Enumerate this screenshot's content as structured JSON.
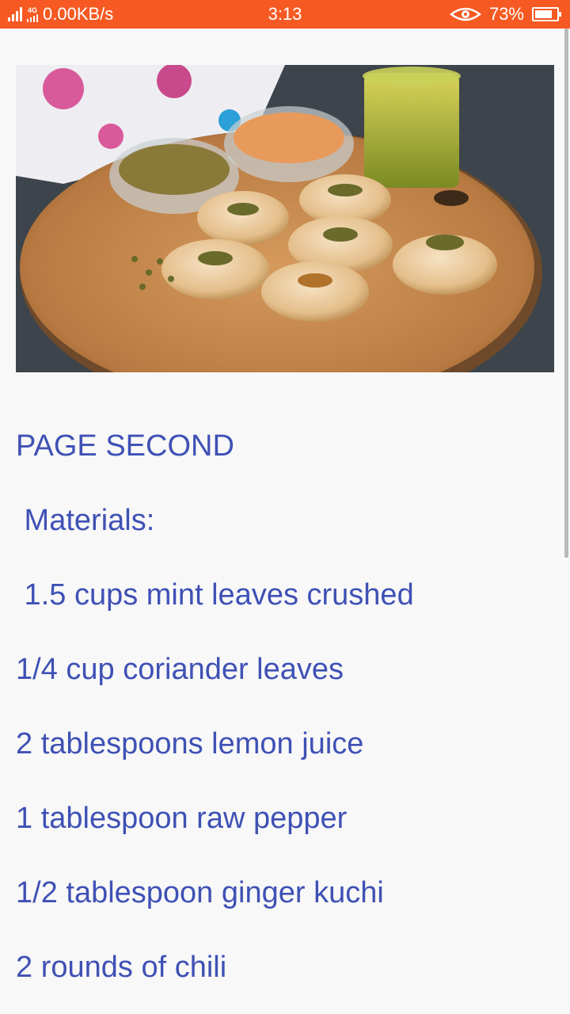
{
  "status_bar": {
    "network_speed": "0.00KB/s",
    "network_type": "4G",
    "time": "3:13",
    "battery": "73%",
    "battery_level": 0.73
  },
  "image": {
    "icon": "food-photo"
  },
  "content": {
    "heading": "PAGE SECOND",
    "lines": [
      " Materials:",
      " 1.5 cups mint leaves crushed",
      "1/4 cup coriander leaves",
      "2 tablespoons lemon juice",
      "1 tablespoon raw pepper",
      "1/2 tablespoon ginger kuchi",
      "2 rounds of chili"
    ]
  },
  "colors": {
    "status_bar": "#f65a22",
    "text": "#3f51b5",
    "background": "#f8f8f8"
  }
}
